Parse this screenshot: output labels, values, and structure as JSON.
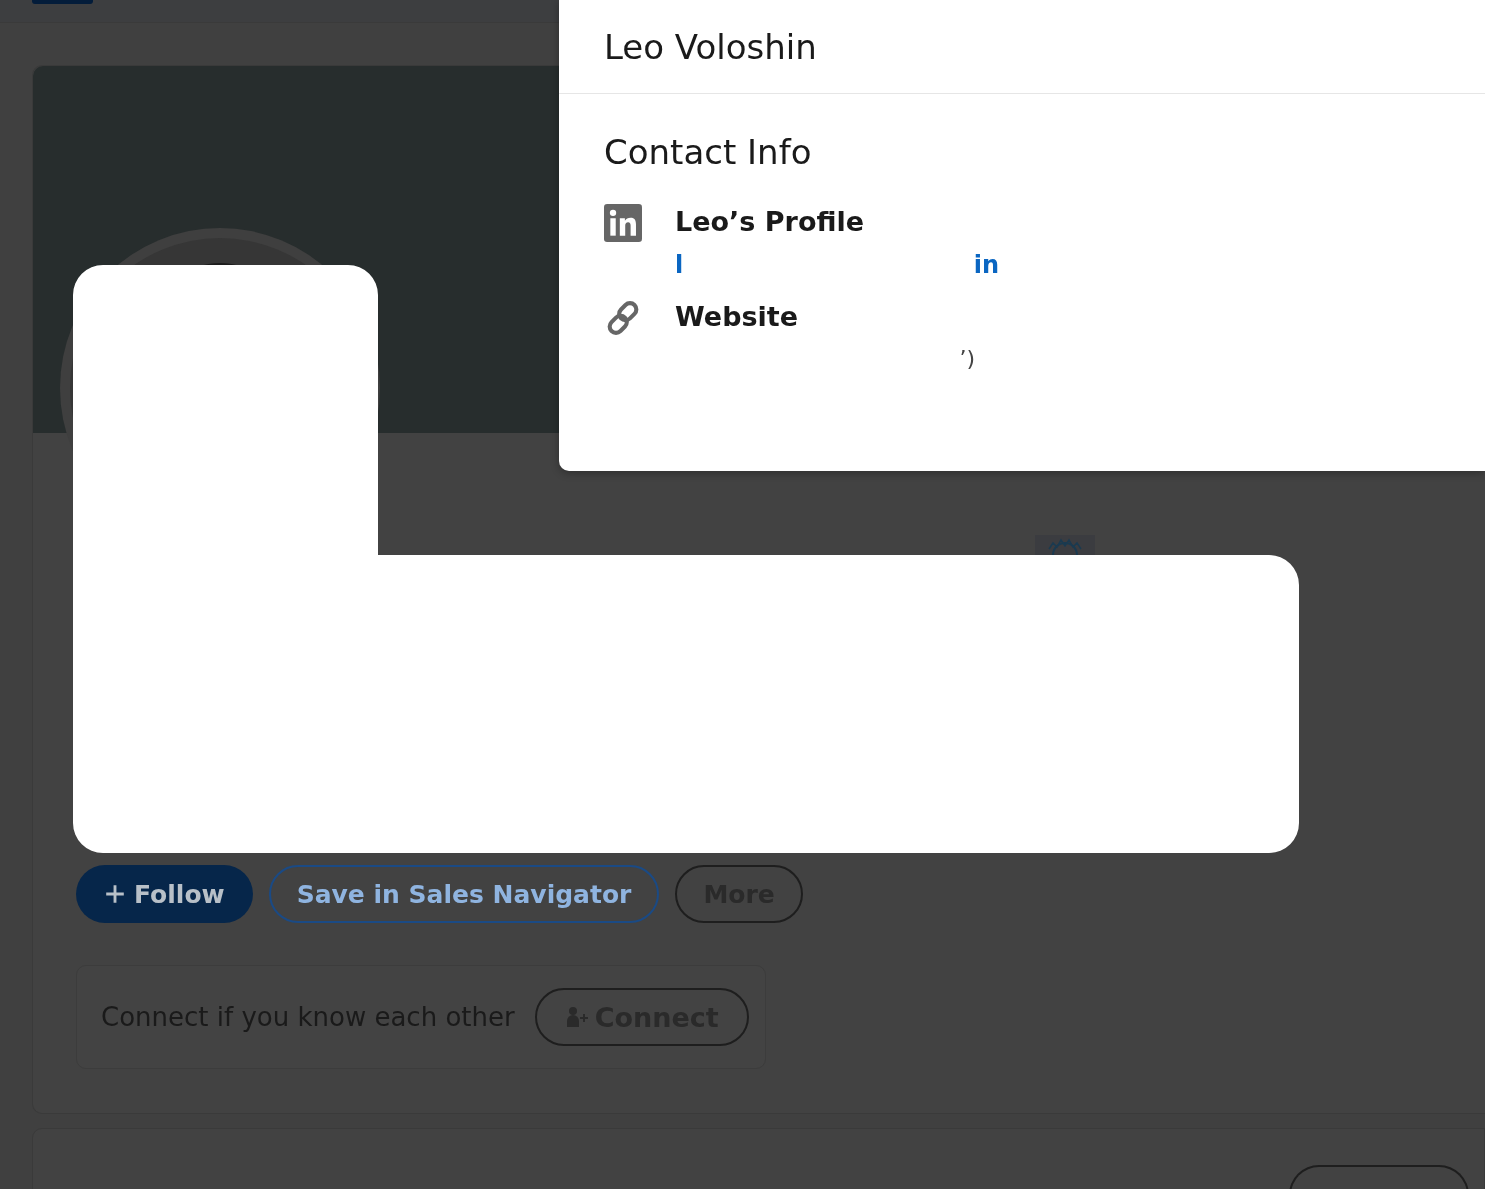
{
  "actions": [
    {
      "label": "Follow",
      "kind": "primary"
    },
    {
      "label": "Save in Sales Navigator",
      "kind": "secondary"
    },
    {
      "label": "More",
      "kind": "neutral"
    }
  ],
  "connect": {
    "text": "Connect if you know each other",
    "button": "Connect"
  },
  "modal": {
    "title": "Leo Voloshin",
    "section_title": "Contact Info",
    "items": [
      {
        "kind": "profile",
        "label": "Leo’s Profile",
        "link_parts": [
          "l",
          "in"
        ]
      },
      {
        "kind": "website",
        "label": "Website",
        "value": "’)"
      }
    ]
  }
}
